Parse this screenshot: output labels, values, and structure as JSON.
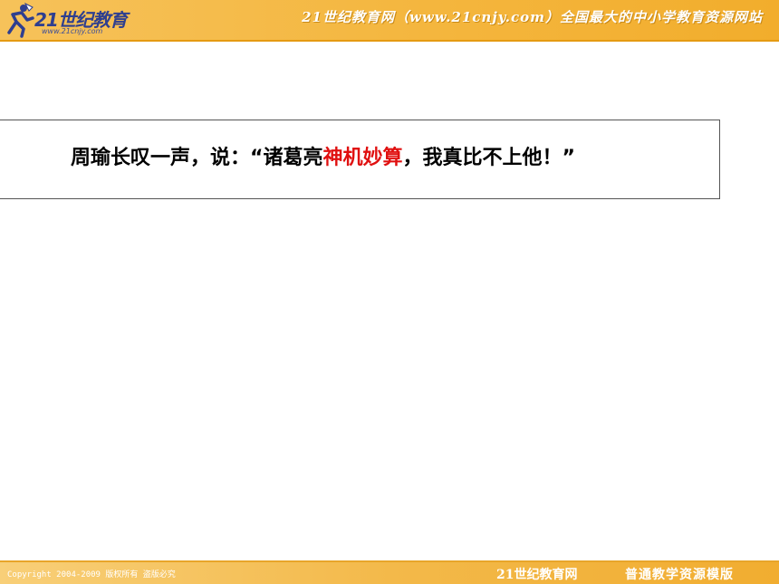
{
  "header": {
    "logo_text": "21世纪教育",
    "logo_url": "www.21cnjy.com",
    "title": "21世纪教育网（www.21cnjy.com）全国最大的中小学教育资源网站"
  },
  "content": {
    "text_before": "周瑜长叹一声，说：“诸葛亮",
    "highlight": "神机妙算",
    "text_after": "，我真比不上他！”",
    "highlight_color": "#e01010"
  },
  "footer": {
    "copyright": "Copyright 2004-2009 版权所有 盗版必究",
    "brand": "21世纪教育网",
    "template": "普通教学资源模版"
  }
}
